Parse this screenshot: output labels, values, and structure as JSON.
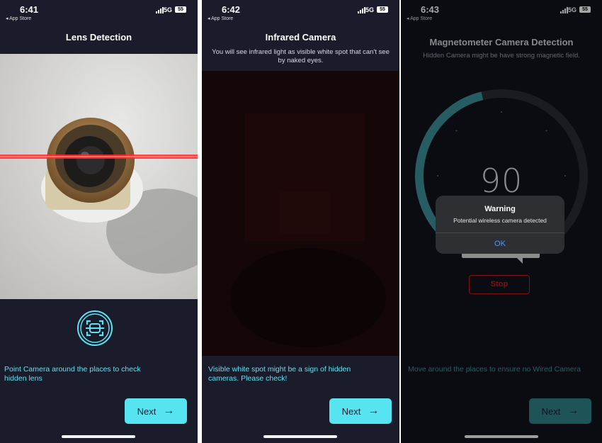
{
  "screens": [
    {
      "status": {
        "time": "6:41",
        "back_link": "◂ App Store",
        "network": "5G",
        "battery": "55"
      },
      "title": "Lens Detection",
      "description": "Point Camera around the places to check hidden lens",
      "next_label": "Next",
      "scan_icon": "face-scan-icon"
    },
    {
      "status": {
        "time": "6:42",
        "back_link": "◂ App Store",
        "network": "5G",
        "battery": "55"
      },
      "title": "Infrared Camera",
      "subtitle": "You will see infrared light as visible white spot that can't see by naked eyes.",
      "description": "Visible white spot might be a sign of hidden cameras. Please check!",
      "next_label": "Next"
    },
    {
      "status": {
        "time": "6:43",
        "back_link": "◂ App Store",
        "network": "5G",
        "battery": "55"
      },
      "title": "Magnetometer Camera Detection",
      "subtitle": "Hidden Camera might be have strong magnetic field.",
      "gauge": {
        "value": "90",
        "fraction": 0.45,
        "accent": "#3a8f97"
      },
      "alert": {
        "title": "Warning",
        "message": "Potential wireless camera detected",
        "ok_label": "OK"
      },
      "stop_label": "Stop",
      "description": "Move around the places to ensure no Wired Camera",
      "next_label": "Next"
    }
  ],
  "colors": {
    "accent": "#55e4f0",
    "text_accent": "#5ee2f1",
    "background": "#1a1c2b",
    "stop": "#c11e1e"
  }
}
